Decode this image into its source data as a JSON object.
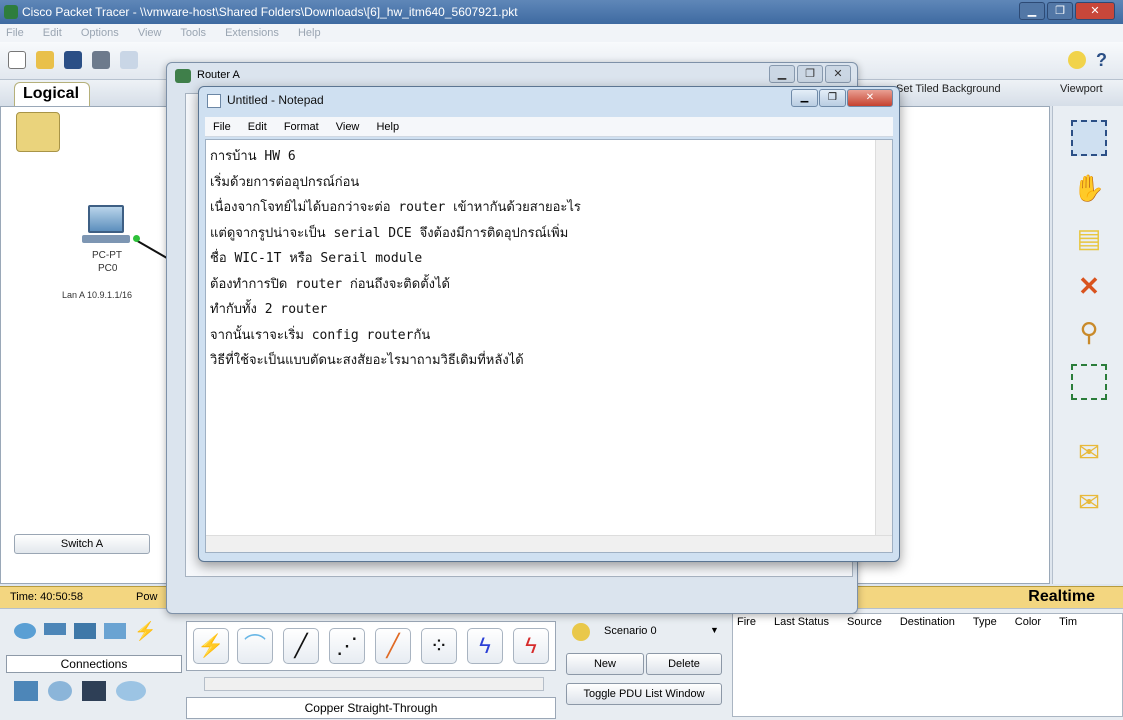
{
  "app": {
    "title": "Cisco Packet Tracer - \\\\vmware-host\\Shared Folders\\Downloads\\[6]_hw_itm640_5607921.pkt",
    "menu": [
      "File",
      "Edit",
      "Options",
      "View",
      "Tools",
      "Extensions",
      "Help"
    ]
  },
  "workspace": {
    "tab_logical": "Logical",
    "set_tiled_background": "Set Tiled Background",
    "viewport": "Viewport",
    "device": {
      "type": "PC-PT",
      "name": "PC0",
      "note": "Lan A 10.9.1.1/16"
    },
    "switch_button": "Switch A"
  },
  "router_window": {
    "title": "Router A"
  },
  "notepad": {
    "title": "Untitled - Notepad",
    "menu": [
      "File",
      "Edit",
      "Format",
      "View",
      "Help"
    ],
    "lines": [
      "การบ้าน HW 6",
      "เริ่มด้วยการต่ออุปกรณ์ก่อน",
      "เนื่องจากโจทย์ไม่ได้บอกว่าจะต่อ router  เข้าหากันด้วยสายอะไร",
      "แต่ดูจากรูปน่าจะเป็น serial DCE  จึงต้องมีการติดอุปกรณ์เพิ่ม",
      "ชื่อ WIC-1T  หรือ Serail module",
      "ต้องทำการปิด router  ก่อนถึงจะติดตั้งได้",
      "ทำกับทั้ง 2 router",
      "จากนั้นเราจะเริ่ม config routerกัน",
      "วิธีที่ใช้จะเป็นแบบตัดนะสงสัยอะไรมาถามวิธีเดิมที่หลังได้"
    ]
  },
  "status": {
    "time": "Time: 40:50:58",
    "power": "Pow",
    "realtime": "Realtime"
  },
  "bottom": {
    "connections": "Connections",
    "cable_name": "Copper Straight-Through",
    "scenario": "Scenario 0",
    "new": "New",
    "delete": "Delete",
    "toggle_pdu": "Toggle PDU List Window",
    "pdu_headers": [
      "Fire",
      "Last Status",
      "Source",
      "Destination",
      "Type",
      "Color",
      "Tim"
    ]
  }
}
